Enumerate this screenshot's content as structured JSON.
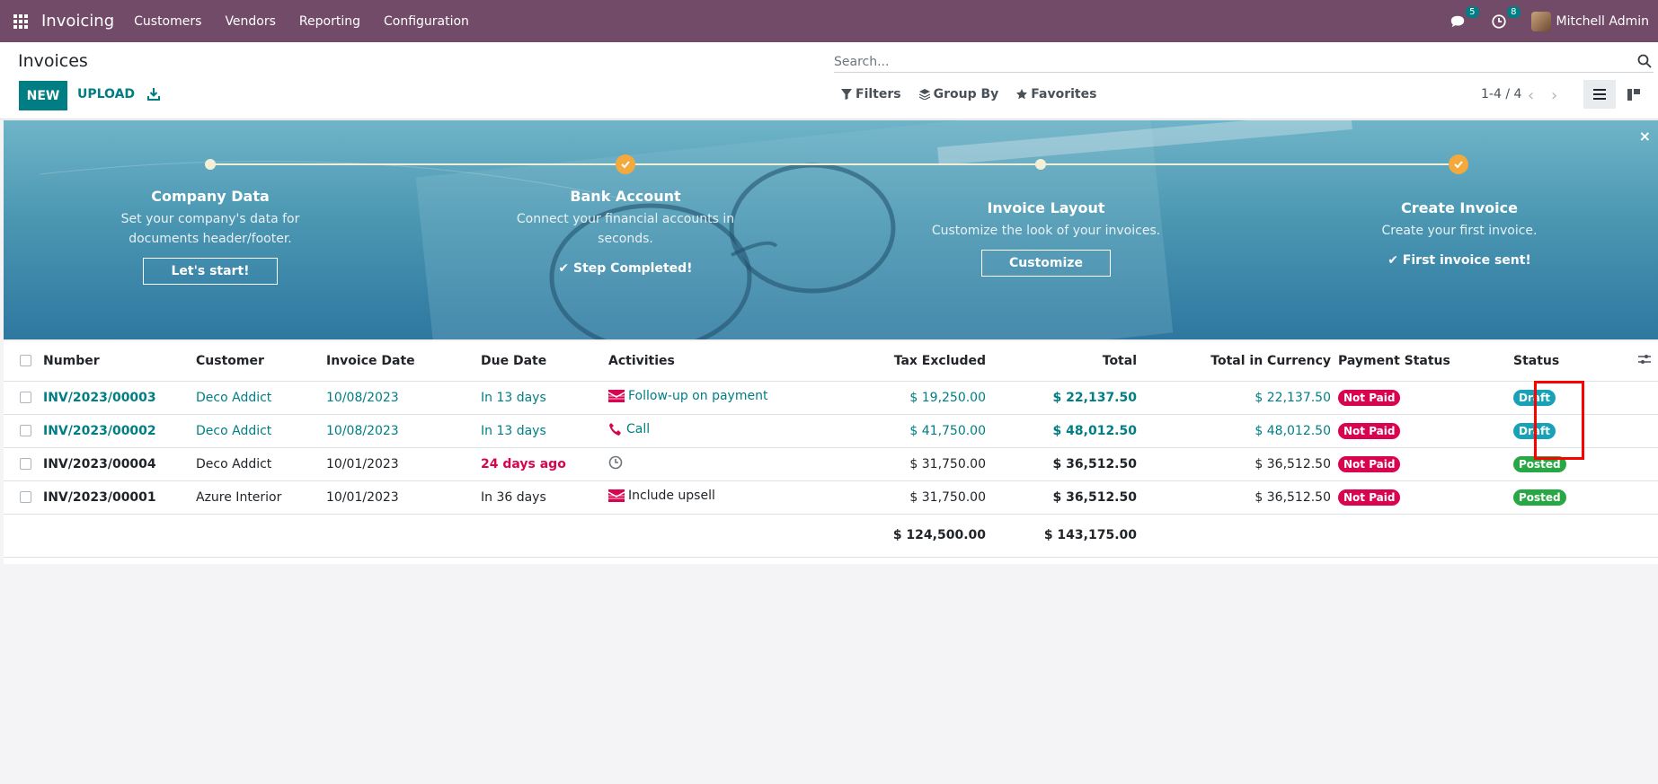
{
  "navbar": {
    "brand": "Invoicing",
    "menu": [
      "Customers",
      "Vendors",
      "Reporting",
      "Configuration"
    ],
    "messages_count": "5",
    "activities_count": "8",
    "user_name": "Mitchell Admin",
    "bg_color": "#714b67"
  },
  "control": {
    "title": "Invoices",
    "new_label": "NEW",
    "upload_label": "UPLOAD",
    "search_placeholder": "Search...",
    "filters_label": "Filters",
    "groupby_label": "Group By",
    "favorites_label": "Favorites",
    "pager": "1-4 / 4"
  },
  "banner": {
    "close": "×",
    "steps": [
      {
        "title": "Company Data",
        "desc": "Set your company's data for documents header/footer.",
        "action": "Let's start!"
      },
      {
        "title": "Bank Account",
        "desc": "Connect your financial accounts in seconds.",
        "done": "Step Completed!"
      },
      {
        "title": "Invoice Layout",
        "desc": "Customize the look of your invoices.",
        "action": "Customize"
      },
      {
        "title": "Create Invoice",
        "desc": "Create your first invoice.",
        "done": "First invoice sent!"
      }
    ]
  },
  "table": {
    "headers": [
      "Number",
      "Customer",
      "Invoice Date",
      "Due Date",
      "Activities",
      "Tax Excluded",
      "Total",
      "Total in Currency",
      "Payment Status",
      "Status"
    ],
    "rows": [
      {
        "number": "INV/2023/00003",
        "customer": "Deco Addict",
        "invoice_date": "10/08/2023",
        "due_date": "In 13 days",
        "activity": "Follow-up on payment",
        "activity_icon": "email-icon",
        "tax_excluded": "$ 19,250.00",
        "total": "$ 22,137.50",
        "total_currency": "$ 22,137.50",
        "payment_status": "Not Paid",
        "status": "Draft"
      },
      {
        "number": "INV/2023/00002",
        "customer": "Deco Addict",
        "invoice_date": "10/08/2023",
        "due_date": "In 13 days",
        "activity": "Call",
        "activity_icon": "phone-icon",
        "tax_excluded": "$ 41,750.00",
        "total": "$ 48,012.50",
        "total_currency": "$ 48,012.50",
        "payment_status": "Not Paid",
        "status": "Draft"
      },
      {
        "number": "INV/2023/00004",
        "customer": "Deco Addict",
        "invoice_date": "10/01/2023",
        "due_date": "24 days ago",
        "activity": "",
        "activity_icon": "clock-icon",
        "tax_excluded": "$ 31,750.00",
        "total": "$ 36,512.50",
        "total_currency": "$ 36,512.50",
        "payment_status": "Not Paid",
        "status": "Posted"
      },
      {
        "number": "INV/2023/00001",
        "customer": "Azure Interior",
        "invoice_date": "10/01/2023",
        "due_date": "In 36 days",
        "activity": "Include upsell",
        "activity_icon": "email-icon",
        "tax_excluded": "$ 31,750.00",
        "total": "$ 36,512.50",
        "total_currency": "$ 36,512.50",
        "payment_status": "Not Paid",
        "status": "Posted"
      }
    ],
    "totals": {
      "tax_excluded": "$ 124,500.00",
      "total": "$ 143,175.00"
    }
  }
}
